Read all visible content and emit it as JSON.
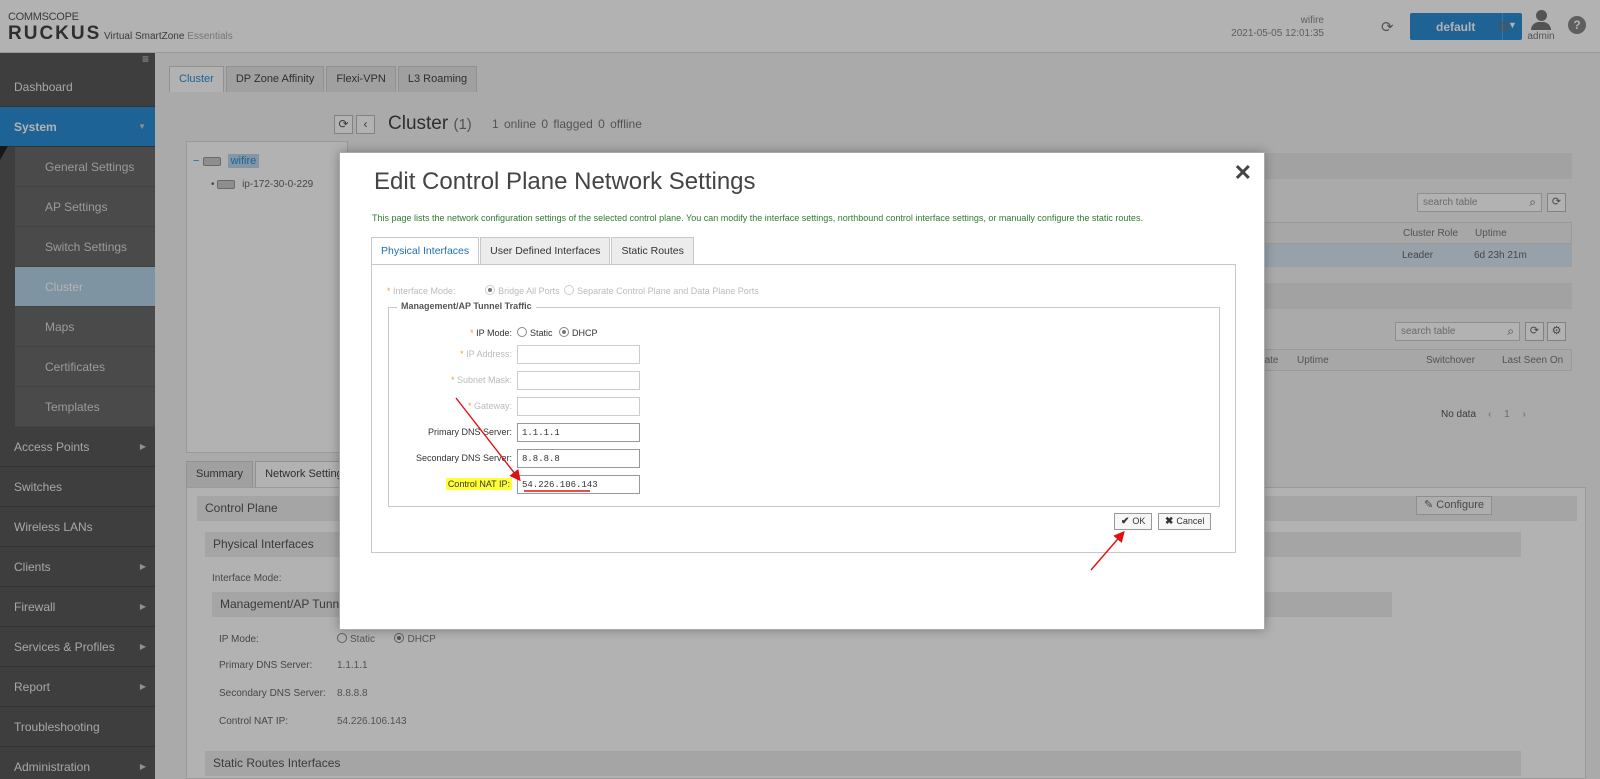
{
  "header": {
    "brand_top": "COMMSCOPE",
    "brand_main": "RUCKUS",
    "product": "Virtual SmartZone",
    "edition": "Essentials",
    "system_name": "wifire",
    "datetime": "2021-05-05 12:01:35",
    "domain": "default",
    "user": "admin",
    "help": "?"
  },
  "sidebar": {
    "toggle": "≡",
    "dashboard": "Dashboard",
    "system": "System",
    "system_sub": [
      "General Settings",
      "AP Settings",
      "Switch Settings",
      "Cluster",
      "Maps",
      "Certificates",
      "Templates"
    ],
    "access_points": "Access Points",
    "switches": "Switches",
    "wireless_lans": "Wireless LANs",
    "clients": "Clients",
    "firewall": "Firewall",
    "services_profiles": "Services & Profiles",
    "report": "Report",
    "troubleshooting": "Troubleshooting",
    "administration": "Administration"
  },
  "main": {
    "tabs": [
      "Cluster",
      "DP Zone Affinity",
      "Flexi-VPN",
      "L3 Roaming"
    ],
    "tree_root": "wifire",
    "tree_node": "ip-172-30-0-229",
    "cluster_title": "Cluster",
    "cluster_count": "(1)",
    "stats": "1 online   0 flagged   0 offline",
    "search_placeholder": "search table",
    "table1_headers": [
      "Cluster Role",
      "Uptime"
    ],
    "table1_row": [
      "Leader",
      "6d 23h 21m"
    ],
    "table2_headers": [
      "ion State",
      "Uptime",
      "Switchover",
      "Last Seen On"
    ],
    "nodata": "No data",
    "pager": "‹ 1 ›",
    "bottom_tabs": [
      "Summary",
      "Network Settings"
    ],
    "control_plane": "Control Plane",
    "configure": "Configure",
    "physical_interfaces": "Physical Interfaces",
    "interface_mode_label": "Interface Mode:",
    "mgmt_section": "Management/AP Tunnel",
    "ip_mode_label": "IP Mode:",
    "ip_mode_static": "Static",
    "ip_mode_dhcp": "DHCP",
    "primary_dns_label": "Primary DNS Server:",
    "primary_dns": "1.1.1.1",
    "secondary_dns_label": "Secondary DNS Server:",
    "secondary_dns": "8.8.8.8",
    "control_nat_label": "Control NAT IP:",
    "control_nat": "54.226.106.143",
    "static_routes": "Static Routes Interfaces"
  },
  "modal": {
    "title": "Edit Control Plane Network Settings",
    "close": "✕",
    "description": "This page lists the network configuration settings of the selected control plane. You can modify the interface settings, northbound control interface settings, or manually configure the static routes.",
    "tabs": [
      "Physical Interfaces",
      "User Defined Interfaces",
      "Static Routes"
    ],
    "interface_mode_label": "Interface Mode:",
    "interface_mode_opt1": "Bridge All Ports",
    "interface_mode_opt2": "Separate Control Plane and Data Plane Ports",
    "legend": "Management/AP Tunnel Traffic",
    "ip_mode_label": "IP Mode:",
    "ip_mode_static": "Static",
    "ip_mode_dhcp": "DHCP",
    "ip_address_label": "IP Address:",
    "subnet_label": "Subnet Mask:",
    "gateway_label": "Gateway:",
    "primary_dns_label": "Primary DNS Server:",
    "primary_dns": "1.1.1.1",
    "secondary_dns_label": "Secondary DNS Server:",
    "secondary_dns": "8.8.8.8",
    "control_nat_label": "Control NAT IP:",
    "control_nat": "54.226.106.143",
    "ok": "OK",
    "cancel": "Cancel"
  },
  "colors": {
    "accent": "#2a8fd6",
    "highlight": "#ffff33",
    "annotation": "#e01010",
    "description": "#2f7a32"
  }
}
